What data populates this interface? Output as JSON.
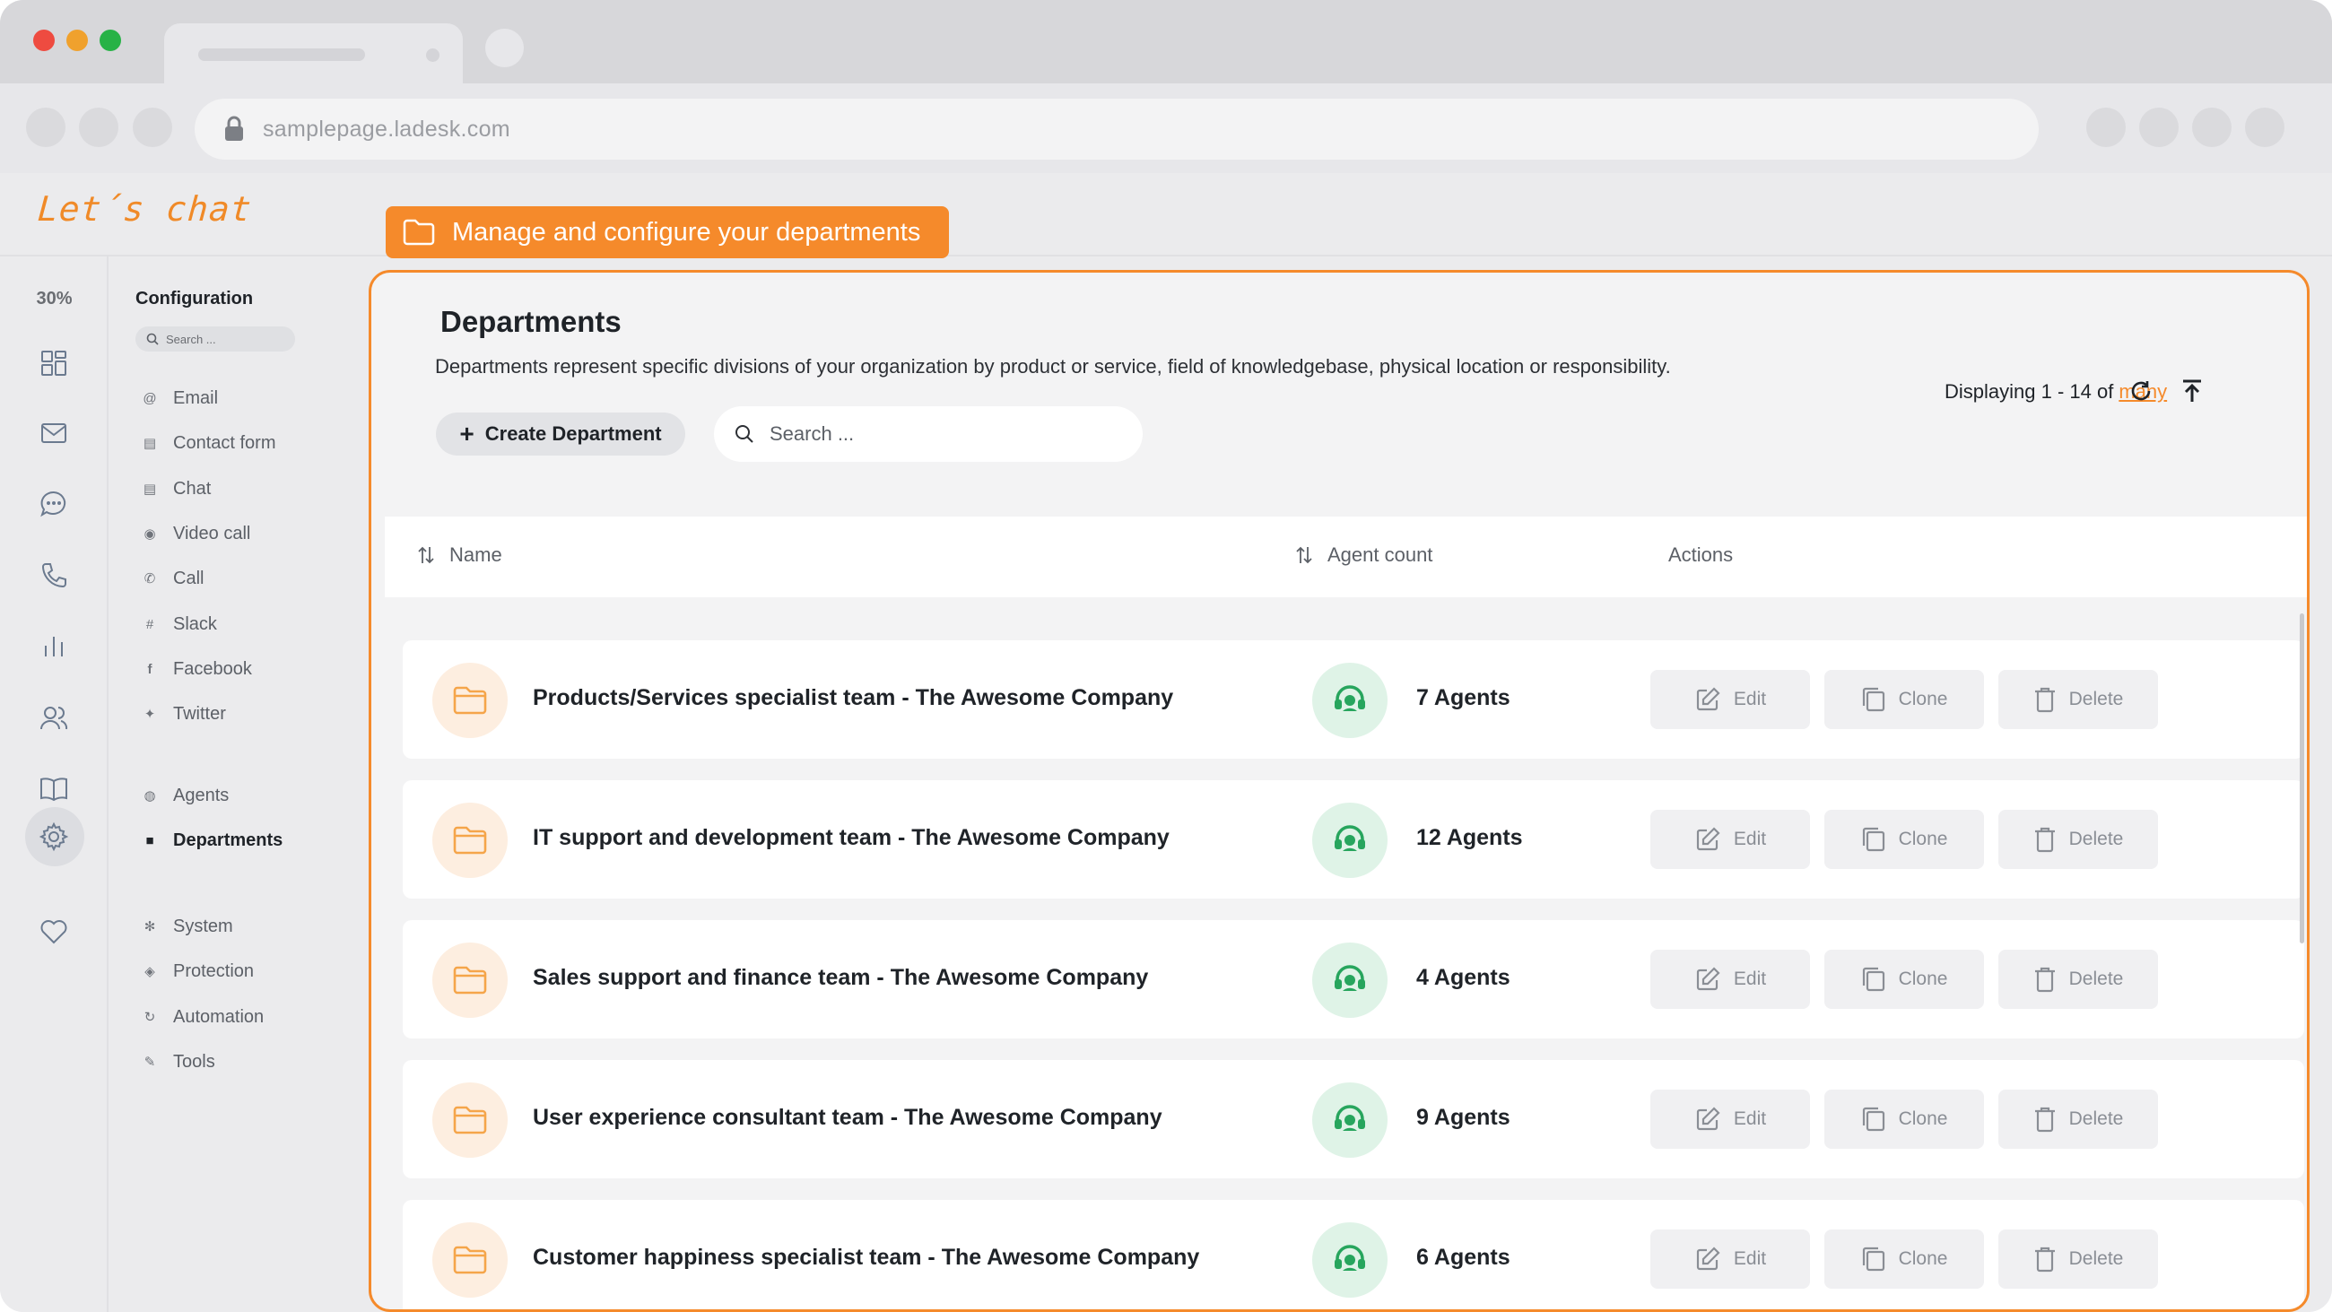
{
  "browser": {
    "url": "samplepage.ladesk.com"
  },
  "app": {
    "logo_text": "Let´s chat",
    "banner_text": "Manage and configure your departments",
    "zoom_level": "30%"
  },
  "menu": {
    "title": "Configuration",
    "search_placeholder": "Search ...",
    "items": [
      {
        "label": "Email",
        "icon": "at-icon"
      },
      {
        "label": "Contact form",
        "icon": "form-icon"
      },
      {
        "label": "Chat",
        "icon": "chat-icon"
      },
      {
        "label": "Video call",
        "icon": "video-icon"
      },
      {
        "label": "Call",
        "icon": "phone-icon"
      },
      {
        "label": "Slack",
        "icon": "slack-icon"
      },
      {
        "label": "Facebook",
        "icon": "facebook-icon"
      },
      {
        "label": "Twitter",
        "icon": "twitter-icon"
      },
      {
        "label": "Agents",
        "icon": "agent-icon"
      },
      {
        "label": "Departments",
        "icon": "folder-icon",
        "active": true
      },
      {
        "label": "System",
        "icon": "gear-icon"
      },
      {
        "label": "Protection",
        "icon": "shield-icon"
      },
      {
        "label": "Automation",
        "icon": "automation-icon"
      },
      {
        "label": "Tools",
        "icon": "wrench-icon"
      }
    ]
  },
  "page": {
    "title": "Departments",
    "description": "Departments represent specific divisions of your organization by product or service, field of knowledgebase, physical location or responsibility.",
    "create_label": "Create Department",
    "search_placeholder": "Search ...",
    "display_prefix": "Displaying 1 - 14 of",
    "display_link": "many"
  },
  "table": {
    "columns": {
      "name": "Name",
      "agent_count": "Agent count",
      "actions": "Actions"
    },
    "action_labels": {
      "edit": "Edit",
      "clone": "Clone",
      "delete": "Delete"
    },
    "rows": [
      {
        "name": "Products/Services specialist team - The Awesome Company",
        "agents": "7 Agents"
      },
      {
        "name": "IT support and development team - The Awesome Company",
        "agents": "12 Agents"
      },
      {
        "name": "Sales support and finance team - The Awesome Company",
        "agents": "4 Agents"
      },
      {
        "name": "User experience consultant team  - The Awesome Company",
        "agents": "9 Agents"
      },
      {
        "name": "Customer happiness specialist team - The Awesome Company",
        "agents": "6 Agents"
      }
    ]
  },
  "colors": {
    "accent": "#f58a2b",
    "agent_green": "#27a55d",
    "folder_orange": "#f5a54a"
  }
}
